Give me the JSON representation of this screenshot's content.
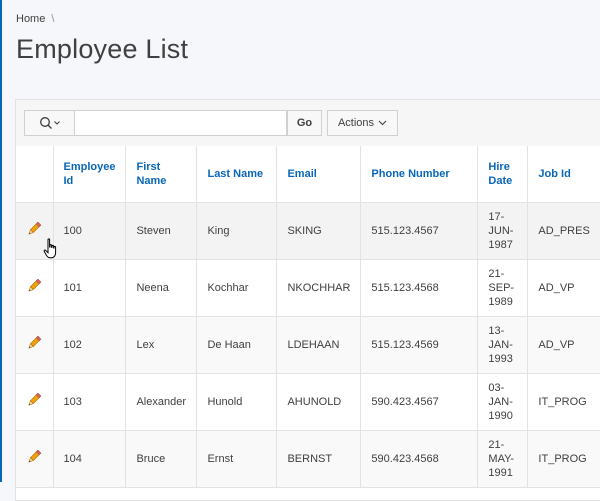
{
  "breadcrumb": {
    "home": "Home",
    "separator": "\\"
  },
  "page_title": "Employee List",
  "toolbar": {
    "search_icon": "search-icon",
    "search_value": "",
    "go_label": "Go",
    "actions_label": "Actions"
  },
  "table": {
    "headers": {
      "employee_id": "Employee Id",
      "first_name": "First Name",
      "last_name": "Last Name",
      "email": "Email",
      "phone": "Phone Number",
      "hire_date": "Hire Date",
      "job_id": "Job Id"
    },
    "rows": [
      {
        "employee_id": "100",
        "first_name": "Steven",
        "last_name": "King",
        "email": "SKING",
        "phone": "515.123.4567",
        "hire_date": "17-JUN-1987",
        "job_id": "AD_PRES"
      },
      {
        "employee_id": "101",
        "first_name": "Neena",
        "last_name": "Kochhar",
        "email": "NKOCHHAR",
        "phone": "515.123.4568",
        "hire_date": "21-SEP-1989",
        "job_id": "AD_VP"
      },
      {
        "employee_id": "102",
        "first_name": "Lex",
        "last_name": "De Haan",
        "email": "LDEHAAN",
        "phone": "515.123.4569",
        "hire_date": "13-JAN-1993",
        "job_id": "AD_VP"
      },
      {
        "employee_id": "103",
        "first_name": "Alexander",
        "last_name": "Hunold",
        "email": "AHUNOLD",
        "phone": "590.423.4567",
        "hire_date": "03-JAN-1990",
        "job_id": "IT_PROG"
      },
      {
        "employee_id": "104",
        "first_name": "Bruce",
        "last_name": "Ernst",
        "email": "BERNST",
        "phone": "590.423.4568",
        "hire_date": "21-MAY-1991",
        "job_id": "IT_PROG"
      }
    ]
  },
  "colors": {
    "accent": "#0a67b7",
    "edit_icon": "#e8a317"
  }
}
